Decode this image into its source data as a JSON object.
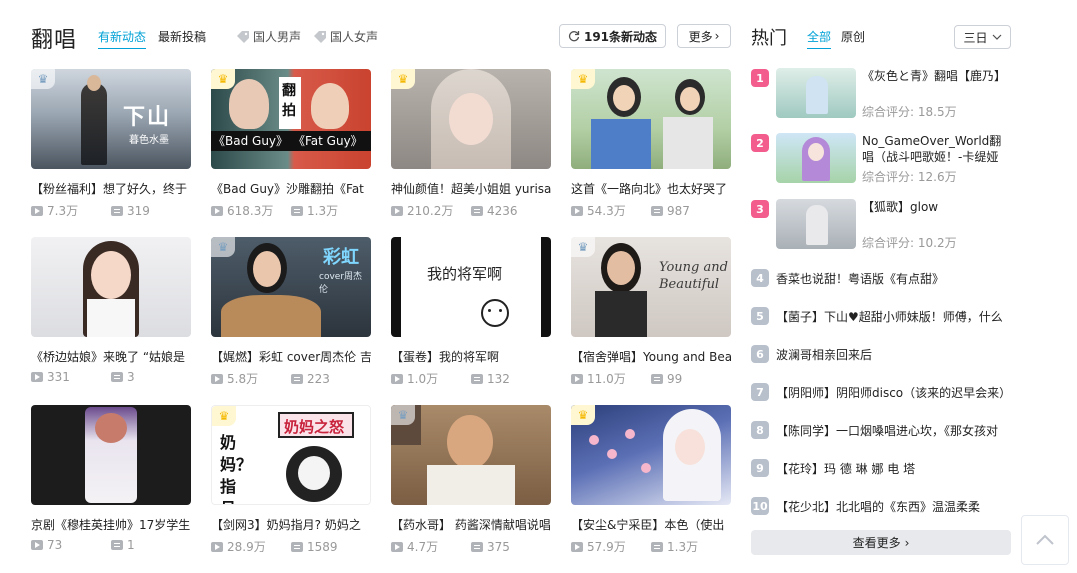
{
  "header": {
    "title": "翻唱",
    "tabs": [
      {
        "label": "有新动态"
      },
      {
        "label": "最新投稿"
      }
    ],
    "tags": [
      {
        "label": "国人男声",
        "icon": "tag-icon"
      },
      {
        "label": "国人女声",
        "icon": "tag-icon"
      }
    ],
    "new_updates": {
      "count": "191条新动态",
      "icon": "refresh-icon"
    },
    "more_label": "更多"
  },
  "videos": [
    {
      "title": "【粉丝福利】想了好久，终于",
      "plays": "7.3万",
      "danmaku": "319",
      "crown": "gray",
      "thumb_text": "下山",
      "thumb_sub": "暮色水墨"
    },
    {
      "title": "《Bad Guy》沙雕翻拍《Fat",
      "plays": "618.3万",
      "danmaku": "1.3万",
      "crown": "gold",
      "thumb_text": "翻拍",
      "thumb_left": "《Bad Guy》",
      "thumb_right": "《Fat Guy》"
    },
    {
      "title": "神仙颜值！超美小姐姐 yurisa",
      "plays": "210.2万",
      "danmaku": "4236",
      "crown": "gold"
    },
    {
      "title": "这首《一路向北》也太好哭了",
      "plays": "54.3万",
      "danmaku": "987",
      "crown": "gold"
    },
    {
      "title": "《桥边姑娘》来晚了 “姑娘是",
      "plays": "331",
      "danmaku": "3",
      "crown": "none"
    },
    {
      "title": "【娓燃】彩虹 cover周杰伦 吉",
      "plays": "5.8万",
      "danmaku": "223",
      "crown": "gray",
      "thumb_text": "彩虹",
      "thumb_sub": "cover周杰伦"
    },
    {
      "title": "【蛋卷】我的将军啊",
      "plays": "1.0万",
      "danmaku": "132",
      "crown": "none",
      "thumb_text": "我的将军啊"
    },
    {
      "title": "【宿舍弹唱】Young and Bea",
      "plays": "11.0万",
      "danmaku": "99",
      "crown": "gray",
      "thumb_text": "Young and Beautiful"
    },
    {
      "title": "京剧《穆桂英挂帅》17岁学生",
      "plays": "73",
      "danmaku": "1",
      "crown": "none"
    },
    {
      "title": "【剑网3】奶妈指月? 奶妈之",
      "plays": "28.9万",
      "danmaku": "1589",
      "crown": "gold",
      "thumb_text": "奶妈之怒",
      "thumb_sub": "奶妈？指月"
    },
    {
      "title": "【药水哥】 药酱深情献唱说唱",
      "plays": "4.7万",
      "danmaku": "375",
      "crown": "gray"
    },
    {
      "title": "【安尘&宁采臣】本色（使出",
      "plays": "57.9万",
      "danmaku": "1.3万",
      "crown": "gold"
    }
  ],
  "rank": {
    "title": "热门",
    "tabs": [
      {
        "label": "全部"
      },
      {
        "label": "原创"
      }
    ],
    "period": "三日",
    "score_label": "综合评分:",
    "top": [
      {
        "num": "1",
        "title": "《灰色と青》翻唱【鹿乃】",
        "score": "18.5万"
      },
      {
        "num": "2",
        "title": "No_GameOver_World翻唱（战斗吧歌姬！-卡缇娅",
        "score": "12.6万"
      },
      {
        "num": "3",
        "title": "【狐歌】glow",
        "score": "10.2万"
      }
    ],
    "items": [
      {
        "num": "4",
        "title": "香菜也说甜！粤语版《有点甜》"
      },
      {
        "num": "5",
        "title": "【菌子】下山♥超甜小师妹版！师傅，什么"
      },
      {
        "num": "6",
        "title": "波澜哥相亲回来后"
      },
      {
        "num": "7",
        "title": "【阴阳师】阴阳师disco（该来的迟早会来）"
      },
      {
        "num": "8",
        "title": "【陈同学】一口烟嗓唱进心坎，《那女孩对"
      },
      {
        "num": "9",
        "title": "【花玲】玛 德 琳 娜 电 塔"
      },
      {
        "num": "10",
        "title": "【花少北】北北唱的《东西》温温柔柔"
      }
    ],
    "see_more": "查看更多"
  },
  "colors": {
    "accent": "#00a1d6",
    "rank_hot": "#f25d8e",
    "rank_plain": "#b8c0cc",
    "crown_gold": "#f5b800"
  }
}
